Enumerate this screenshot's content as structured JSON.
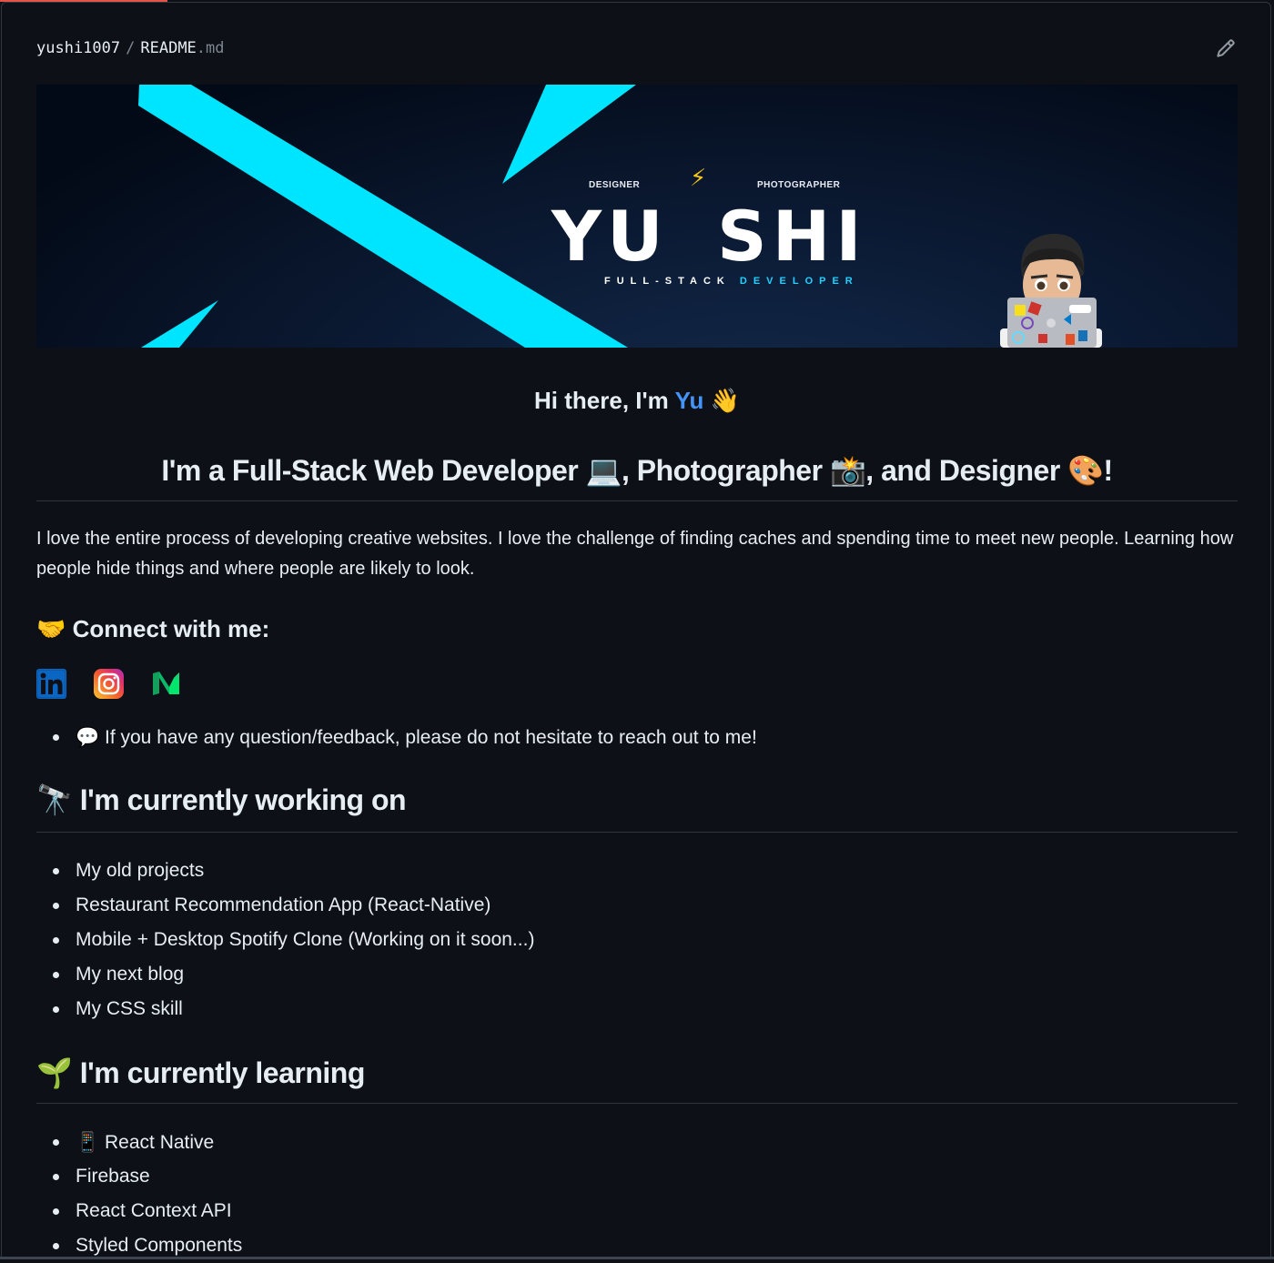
{
  "file_header": {
    "owner": "yushi1007",
    "separator": "/",
    "filename": "README",
    "extension": ".md",
    "edit_icon": "pencil-icon"
  },
  "banner": {
    "role_left": "DESIGNER",
    "role_right": "PHOTOGRAPHER",
    "bolt_icon": "⚡",
    "name_first": "YU",
    "name_last": "SHI",
    "tagline_main": "FULL-STACK ",
    "tagline_accent": "DEVELOPER",
    "accent_color": "#00e5ff",
    "avatar_icon": "memoji-with-laptop"
  },
  "greeting": {
    "prefix": "Hi there, I'm ",
    "highlight": "Yu",
    "emoji": "👋"
  },
  "headline": {
    "text_1": "I'm a Full-Stack Web Developer ",
    "emoji_1": "💻",
    "text_2": ", Photographer ",
    "emoji_2": "📸",
    "text_3": ", and Designer ",
    "emoji_3": "🎨",
    "text_4": "!"
  },
  "intro": "I love the entire process of developing creative websites. I love the challenge of finding caches and spending time to meet new people. Learning how people hide things and where people are likely to look.",
  "connect": {
    "emoji": "🤝",
    "title": "Connect with me:",
    "links": [
      {
        "name": "linkedin",
        "icon": "linkedin-icon"
      },
      {
        "name": "instagram",
        "icon": "instagram-icon"
      },
      {
        "name": "medium",
        "icon": "medium-icon"
      }
    ],
    "feedback_emoji": "💬",
    "feedback": "If you have any question/feedback, please do not hesitate to reach out to me!"
  },
  "working_on": {
    "emoji": "🔭",
    "title": "I'm currently working on",
    "items": [
      "My old projects",
      "Restaurant Recommendation App (React-Native)",
      "Mobile + Desktop Spotify Clone (Working on it soon...)",
      "My next blog",
      "My CSS skill"
    ]
  },
  "learning": {
    "emoji": "🌱",
    "title": "I'm currently learning",
    "items": [
      {
        "emoji": "📱",
        "text": "React Native"
      },
      {
        "emoji": "",
        "text": "Firebase"
      },
      {
        "emoji": "",
        "text": "React Context API"
      },
      {
        "emoji": "",
        "text": "Styled Components"
      }
    ]
  }
}
